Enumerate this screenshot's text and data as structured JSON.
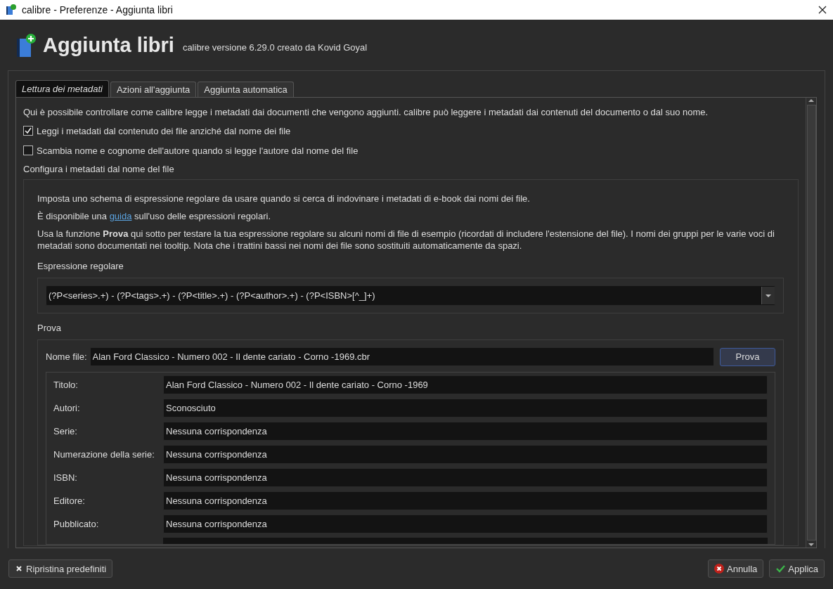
{
  "window": {
    "title": "calibre - Preferenze - Aggiunta libri"
  },
  "header": {
    "title": "Aggiunta libri",
    "subtitle": "calibre versione 6.29.0 creato da Kovid Goyal"
  },
  "tabs": [
    {
      "label": "Lettura dei metadati",
      "selected": true
    },
    {
      "label": "Azioni all'aggiunta",
      "selected": false
    },
    {
      "label": "Aggiunta automatica",
      "selected": false
    }
  ],
  "intro": "Qui è possibile controllare come calibre legge i metadati dai documenti che vengono aggiunti. calibre può leggere i metadati dai contenuti del documento o dal suo nome.",
  "options": [
    {
      "label": "Leggi i metadati dal contenuto dei file anziché dal nome dei file",
      "checked": true
    },
    {
      "label": "Scambia nome e cognome dell'autore quando si legge l'autore dal nome del file",
      "checked": false
    }
  ],
  "filename_section": {
    "title": "Configura i metadati dal nome del file",
    "paragraph_1": "Imposta uno schema di espressione regolare da usare quando si cerca di indovinare i metadati di e-book dai nomi dei file.",
    "paragraph_2": {
      "before": "È disponibile una ",
      "link": "guida",
      "after": " sull'uso delle espressioni regolari."
    },
    "paragraph_3": "Usa la funzione **Prova** qui sotto per testare la tua espressione regolare su alcuni nomi di file di esempio (ricordati di includere l'estensione del file). I nomi dei gruppi per le varie voci di metadati sono documentati nei tooltip. Nota che i trattini bassi nei nomi dei file sono sostituiti automaticamente da spazi.",
    "regex_label": "Espressione regolare",
    "regex_value": "(?P<series>.+) - (?P<tags>.+) - (?P<title>.+) - (?P<author>.+) - (?P<ISBN>[^_]+)",
    "test_title": "Prova",
    "filename_label": "Nome file:",
    "filename_value": "Alan Ford Classico - Numero 002 - Il dente cariato - Corno -1969.cbr",
    "test_button": "Prova",
    "results": [
      {
        "label": "Titolo:",
        "value": "Alan Ford Classico - Numero 002 - Il dente cariato - Corno -1969"
      },
      {
        "label": "Autori:",
        "value": "Sconosciuto"
      },
      {
        "label": "Serie:",
        "value": "Nessuna corrispondenza"
      },
      {
        "label": "Numerazione della serie:",
        "value": "Nessuna corrispondenza"
      },
      {
        "label": "ISBN:",
        "value": "Nessuna corrispondenza"
      },
      {
        "label": "Editore:",
        "value": "Nessuna corrispondenza"
      },
      {
        "label": "Pubblicato:",
        "value": "Nessuna corrispondenza"
      }
    ]
  },
  "buttons": {
    "reset": "Ripristina predefiniti",
    "cancel": "Annulla",
    "apply": "Applica"
  }
}
